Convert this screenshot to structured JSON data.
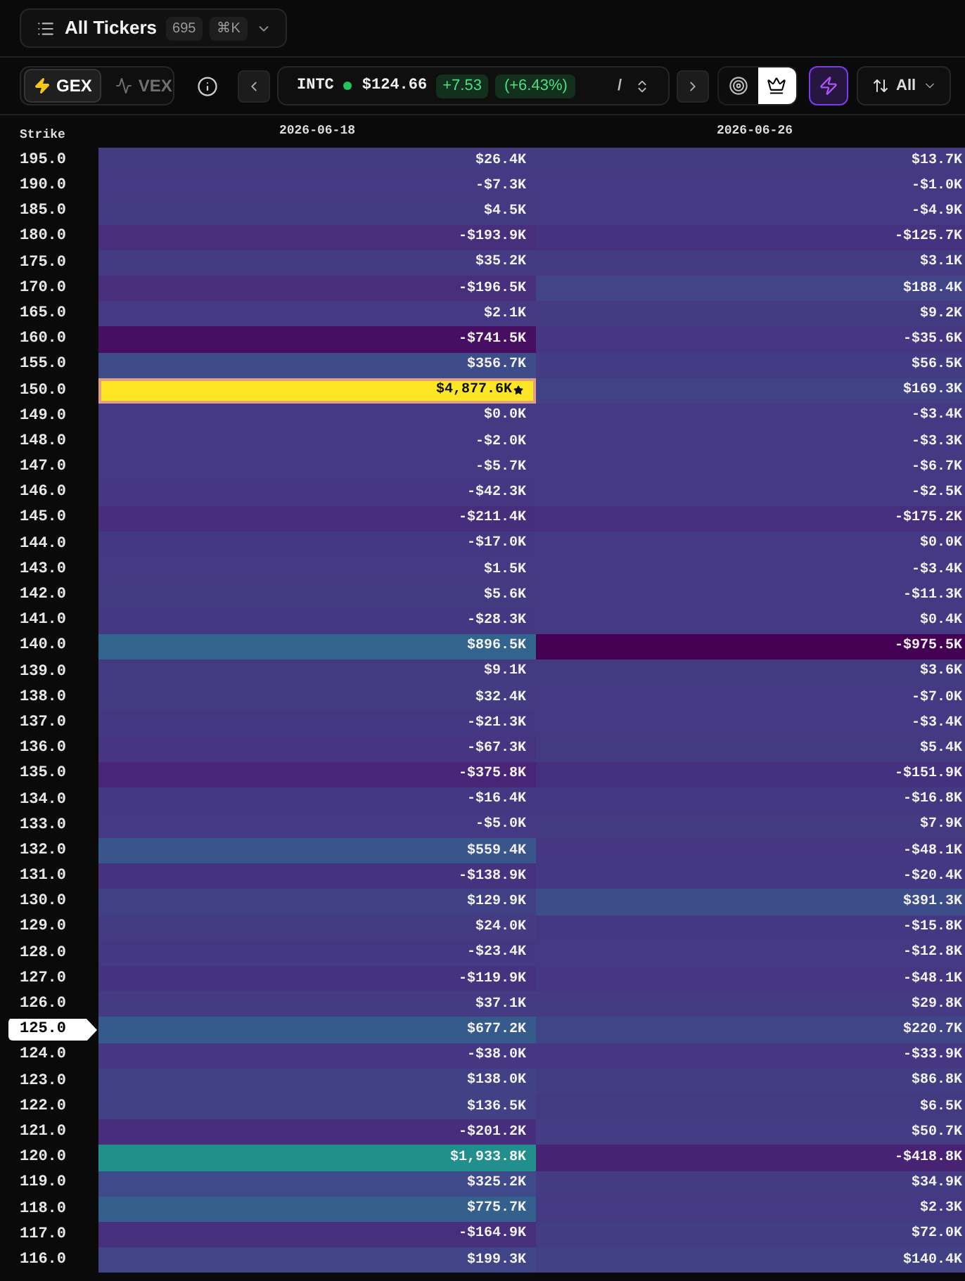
{
  "ticker_picker": {
    "label": "All Tickers",
    "count": "695",
    "shortcut": "⌘K"
  },
  "toolbar": {
    "modes": [
      {
        "label": "GEX",
        "selected": true
      },
      {
        "label": "VEX",
        "selected": false
      }
    ],
    "ticker": {
      "symbol": "INTC",
      "price": "$124.66",
      "change": "+7.53",
      "change_percent": "(+6.43%)",
      "shortcut": "/"
    },
    "views": [
      {
        "selected": false
      },
      {
        "selected": true
      }
    ],
    "flow_button": {
      "on": true
    },
    "sort": {
      "label": "All"
    }
  },
  "table": {
    "columns": [
      "Strike",
      "2026-06-18",
      "2026-06-26"
    ],
    "rows": [
      {
        "strike": "195.0",
        "current": false,
        "cells": [
          {
            "value": "$26.4K",
            "color": "#443b83",
            "peak": false
          },
          {
            "value": "$13.7K",
            "color": "#443a82",
            "peak": false
          }
        ]
      },
      {
        "strike": "190.0",
        "current": false,
        "cells": [
          {
            "value": "-$7.3K",
            "color": "#443982",
            "peak": false
          },
          {
            "value": "-$1.0K",
            "color": "#443982",
            "peak": false
          }
        ]
      },
      {
        "strike": "185.0",
        "current": false,
        "cells": [
          {
            "value": "$4.5K",
            "color": "#443a82",
            "peak": false
          },
          {
            "value": "-$4.9K",
            "color": "#443982",
            "peak": false
          }
        ]
      },
      {
        "strike": "180.0",
        "current": false,
        "cells": [
          {
            "value": "-$193.9K",
            "color": "#472f7c",
            "peak": false
          },
          {
            "value": "-$125.7K",
            "color": "#46327f",
            "peak": false
          }
        ]
      },
      {
        "strike": "175.0",
        "current": false,
        "cells": [
          {
            "value": "$35.2K",
            "color": "#443b83",
            "peak": false
          },
          {
            "value": "$3.1K",
            "color": "#443a82",
            "peak": false
          }
        ]
      },
      {
        "strike": "170.0",
        "current": false,
        "cells": [
          {
            "value": "-$196.5K",
            "color": "#472f7c",
            "peak": false
          },
          {
            "value": "$188.4K",
            "color": "#414487",
            "peak": false
          }
        ]
      },
      {
        "strike": "165.0",
        "current": false,
        "cells": [
          {
            "value": "$2.1K",
            "color": "#443982",
            "peak": false
          },
          {
            "value": "$9.2K",
            "color": "#443a82",
            "peak": false
          }
        ]
      },
      {
        "strike": "160.0",
        "current": false,
        "cells": [
          {
            "value": "-$741.5K",
            "color": "#460f62",
            "peak": false
          },
          {
            "value": "-$35.6K",
            "color": "#453781",
            "peak": false
          }
        ]
      },
      {
        "strike": "155.0",
        "current": false,
        "cells": [
          {
            "value": "$356.7K",
            "color": "#3e4c89",
            "peak": false
          },
          {
            "value": "$56.5K",
            "color": "#433c84",
            "peak": false
          }
        ]
      },
      {
        "strike": "150.0",
        "current": false,
        "cells": [
          {
            "value": "$4,877.6K",
            "color": "#fde725",
            "peak": true
          },
          {
            "value": "$169.3K",
            "color": "#414386",
            "peak": false
          }
        ]
      },
      {
        "strike": "149.0",
        "current": false,
        "cells": [
          {
            "value": "$0.0K",
            "color": "#443982",
            "peak": false
          },
          {
            "value": "-$3.4K",
            "color": "#443982",
            "peak": false
          }
        ]
      },
      {
        "strike": "148.0",
        "current": false,
        "cells": [
          {
            "value": "-$2.0K",
            "color": "#443982",
            "peak": false
          },
          {
            "value": "-$3.3K",
            "color": "#443982",
            "peak": false
          }
        ]
      },
      {
        "strike": "147.0",
        "current": false,
        "cells": [
          {
            "value": "-$5.7K",
            "color": "#443982",
            "peak": false
          },
          {
            "value": "-$6.7K",
            "color": "#443982",
            "peak": false
          }
        ]
      },
      {
        "strike": "146.0",
        "current": false,
        "cells": [
          {
            "value": "-$42.3K",
            "color": "#453781",
            "peak": false
          },
          {
            "value": "-$2.5K",
            "color": "#443982",
            "peak": false
          }
        ]
      },
      {
        "strike": "145.0",
        "current": false,
        "cells": [
          {
            "value": "-$211.4K",
            "color": "#472e7c",
            "peak": false
          },
          {
            "value": "-$175.2K",
            "color": "#46307d",
            "peak": false
          }
        ]
      },
      {
        "strike": "144.0",
        "current": false,
        "cells": [
          {
            "value": "-$17.0K",
            "color": "#453882",
            "peak": false
          },
          {
            "value": "$0.0K",
            "color": "#443982",
            "peak": false
          }
        ]
      },
      {
        "strike": "143.0",
        "current": false,
        "cells": [
          {
            "value": "$1.5K",
            "color": "#443982",
            "peak": false
          },
          {
            "value": "-$3.4K",
            "color": "#443982",
            "peak": false
          }
        ]
      },
      {
        "strike": "142.0",
        "current": false,
        "cells": [
          {
            "value": "$5.6K",
            "color": "#443a82",
            "peak": false
          },
          {
            "value": "-$11.3K",
            "color": "#443982",
            "peak": false
          }
        ]
      },
      {
        "strike": "141.0",
        "current": false,
        "cells": [
          {
            "value": "-$28.3K",
            "color": "#453882",
            "peak": false
          },
          {
            "value": "$0.4K",
            "color": "#443982",
            "peak": false
          }
        ]
      },
      {
        "strike": "140.0",
        "current": false,
        "cells": [
          {
            "value": "$896.5K",
            "color": "#33648d",
            "peak": false
          },
          {
            "value": "-$975.5K",
            "color": "#440154",
            "peak": false
          }
        ]
      },
      {
        "strike": "139.0",
        "current": false,
        "cells": [
          {
            "value": "$9.1K",
            "color": "#443a82",
            "peak": false
          },
          {
            "value": "$3.6K",
            "color": "#443a82",
            "peak": false
          }
        ]
      },
      {
        "strike": "138.0",
        "current": false,
        "cells": [
          {
            "value": "$32.4K",
            "color": "#443b83",
            "peak": false
          },
          {
            "value": "-$7.0K",
            "color": "#443982",
            "peak": false
          }
        ]
      },
      {
        "strike": "137.0",
        "current": false,
        "cells": [
          {
            "value": "-$21.3K",
            "color": "#453882",
            "peak": false
          },
          {
            "value": "-$3.4K",
            "color": "#443982",
            "peak": false
          }
        ]
      },
      {
        "strike": "136.0",
        "current": false,
        "cells": [
          {
            "value": "-$67.3K",
            "color": "#463681",
            "peak": false
          },
          {
            "value": "$5.4K",
            "color": "#443a82",
            "peak": false
          }
        ]
      },
      {
        "strike": "135.0",
        "current": false,
        "cells": [
          {
            "value": "-$375.8K",
            "color": "#482576",
            "peak": false
          },
          {
            "value": "-$151.9K",
            "color": "#46317e",
            "peak": false
          }
        ]
      },
      {
        "strike": "134.0",
        "current": false,
        "cells": [
          {
            "value": "-$16.4K",
            "color": "#453882",
            "peak": false
          },
          {
            "value": "-$16.8K",
            "color": "#453882",
            "peak": false
          }
        ]
      },
      {
        "strike": "133.0",
        "current": false,
        "cells": [
          {
            "value": "-$5.0K",
            "color": "#443982",
            "peak": false
          },
          {
            "value": "$7.9K",
            "color": "#443a82",
            "peak": false
          }
        ]
      },
      {
        "strike": "132.0",
        "current": false,
        "cells": [
          {
            "value": "$559.4K",
            "color": "#3a558c",
            "peak": false
          },
          {
            "value": "-$48.1K",
            "color": "#453781",
            "peak": false
          }
        ]
      },
      {
        "strike": "131.0",
        "current": false,
        "cells": [
          {
            "value": "-$138.9K",
            "color": "#46327e",
            "peak": false
          },
          {
            "value": "-$20.4K",
            "color": "#453882",
            "peak": false
          }
        ]
      },
      {
        "strike": "130.0",
        "current": false,
        "cells": [
          {
            "value": "$129.9K",
            "color": "#424085",
            "peak": false
          },
          {
            "value": "$391.3K",
            "color": "#3d4d8a",
            "peak": false
          }
        ]
      },
      {
        "strike": "129.0",
        "current": false,
        "cells": [
          {
            "value": "$24.0K",
            "color": "#443b83",
            "peak": false
          },
          {
            "value": "-$15.8K",
            "color": "#453882",
            "peak": false
          }
        ]
      },
      {
        "strike": "128.0",
        "current": false,
        "cells": [
          {
            "value": "-$23.4K",
            "color": "#453882",
            "peak": false
          },
          {
            "value": "-$12.8K",
            "color": "#443982",
            "peak": false
          }
        ]
      },
      {
        "strike": "127.0",
        "current": false,
        "cells": [
          {
            "value": "-$119.9K",
            "color": "#46337f",
            "peak": false
          },
          {
            "value": "-$48.1K",
            "color": "#453781",
            "peak": false
          }
        ]
      },
      {
        "strike": "126.0",
        "current": false,
        "cells": [
          {
            "value": "$37.1K",
            "color": "#443b83",
            "peak": false
          },
          {
            "value": "$29.8K",
            "color": "#443b83",
            "peak": false
          }
        ]
      },
      {
        "strike": "125.0",
        "current": true,
        "cells": [
          {
            "value": "$677.2K",
            "color": "#375a8c",
            "peak": false
          },
          {
            "value": "$220.7K",
            "color": "#404587",
            "peak": false
          }
        ]
      },
      {
        "strike": "124.0",
        "current": false,
        "cells": [
          {
            "value": "-$38.0K",
            "color": "#453781",
            "peak": false
          },
          {
            "value": "-$33.9K",
            "color": "#453781",
            "peak": false
          }
        ]
      },
      {
        "strike": "123.0",
        "current": false,
        "cells": [
          {
            "value": "$138.0K",
            "color": "#424186",
            "peak": false
          },
          {
            "value": "$86.8K",
            "color": "#433e84",
            "peak": false
          }
        ]
      },
      {
        "strike": "122.0",
        "current": false,
        "cells": [
          {
            "value": "$136.5K",
            "color": "#424186",
            "peak": false
          },
          {
            "value": "$6.5K",
            "color": "#443a82",
            "peak": false
          }
        ]
      },
      {
        "strike": "121.0",
        "current": false,
        "cells": [
          {
            "value": "-$201.2K",
            "color": "#472e7c",
            "peak": false
          },
          {
            "value": "$50.7K",
            "color": "#443c84",
            "peak": false
          }
        ]
      },
      {
        "strike": "120.0",
        "current": false,
        "cells": [
          {
            "value": "$1,933.8K",
            "color": "#21908c",
            "peak": false
          },
          {
            "value": "-$418.8K",
            "color": "#482273",
            "peak": false
          }
        ]
      },
      {
        "strike": "119.0",
        "current": false,
        "cells": [
          {
            "value": "$325.2K",
            "color": "#3e4a89",
            "peak": false
          },
          {
            "value": "$34.9K",
            "color": "#443b83",
            "peak": false
          }
        ]
      },
      {
        "strike": "118.0",
        "current": false,
        "cells": [
          {
            "value": "$775.7K",
            "color": "#355f8d",
            "peak": false
          },
          {
            "value": "$2.3K",
            "color": "#443982",
            "peak": false
          }
        ]
      },
      {
        "strike": "117.0",
        "current": false,
        "cells": [
          {
            "value": "-$164.9K",
            "color": "#46307e",
            "peak": false
          },
          {
            "value": "$72.0K",
            "color": "#433d84",
            "peak": false
          }
        ]
      },
      {
        "strike": "116.0",
        "current": false,
        "cells": [
          {
            "value": "$199.3K",
            "color": "#414487",
            "peak": false
          },
          {
            "value": "$140.4K",
            "color": "#424186",
            "peak": false
          }
        ]
      }
    ]
  }
}
